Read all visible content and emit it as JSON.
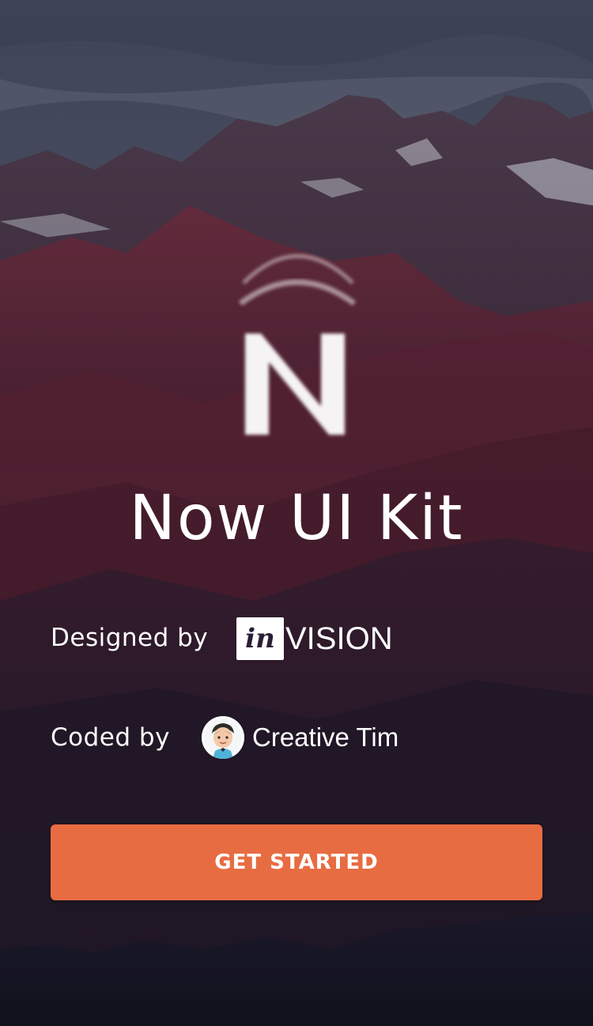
{
  "hero": {
    "logo_letter": "N",
    "title": "Now UI Kit"
  },
  "credits": {
    "designed_label": "Designed by",
    "designer_logo_mark": "in",
    "designer_logo_text": "VISION",
    "coded_label": "Coded by",
    "coder_name": "Creative Tim",
    "coder_avatar_icon": "creative-tim-avatar-icon"
  },
  "action": {
    "get_started_label": "GET STARTED"
  },
  "colors": {
    "accent": "#e86c42",
    "text": "#ffffff",
    "sky": "#3a4157",
    "mountain": "#5a2a3a"
  },
  "icons": {
    "logo": "now-ui-logo-icon",
    "background": "mountain-landscape-image"
  }
}
